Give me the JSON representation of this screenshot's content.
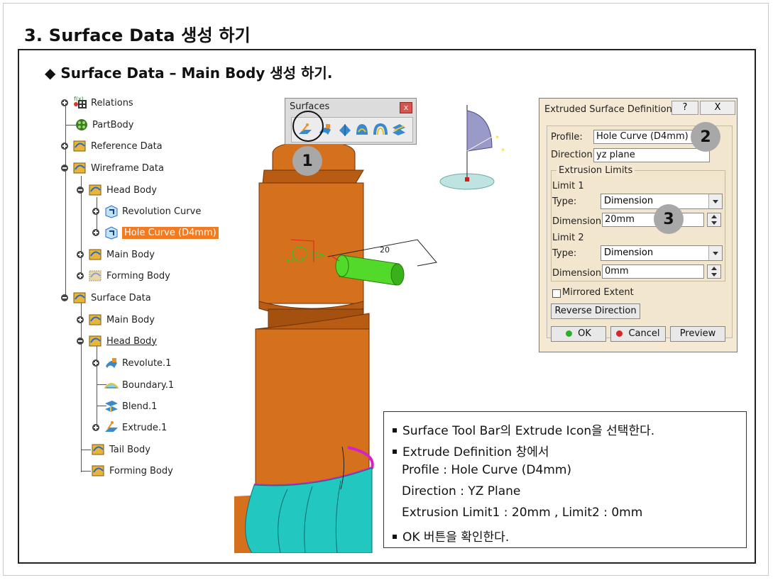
{
  "page": {
    "title": "3. Surface Data 생성 하기",
    "subtitle": "◆ Surface Data – Main Body 생성 하기."
  },
  "tree": {
    "items": [
      {
        "label": "Relations"
      },
      {
        "label": "PartBody"
      },
      {
        "label": "Reference Data"
      },
      {
        "label": "Wireframe Data"
      },
      {
        "label": "Head Body"
      },
      {
        "label": "Revolution Curve"
      },
      {
        "label": "Hole Curve (D4mm)"
      },
      {
        "label": "Main Body"
      },
      {
        "label": "Forming Body"
      },
      {
        "label": "Surface Data"
      },
      {
        "label": "Main Body"
      },
      {
        "label": "Head Body"
      },
      {
        "label": "Revolute.1"
      },
      {
        "label": "Boundary.1"
      },
      {
        "label": "Blend.1"
      },
      {
        "label": "Extrude.1"
      },
      {
        "label": "Tail Body"
      },
      {
        "label": "Forming Body"
      }
    ]
  },
  "toolbar": {
    "title": "Surfaces",
    "close": "x",
    "icons": [
      "extrude-icon",
      "revolve-icon",
      "sphere-icon",
      "cylinder-icon",
      "offset-icon",
      "variable-offset-icon"
    ]
  },
  "viewport": {
    "dimension": "20",
    "limit_label": "Limit 1",
    "colors": {
      "body": "#d5701d",
      "body_dark": "#8a3f08",
      "cylinder": "#52d92a",
      "surface": "#22c8c0",
      "edge": "#d522c8"
    }
  },
  "badges": {
    "b1": "1",
    "b2": "2",
    "b3": "3"
  },
  "dialog": {
    "title": "Extruded Surface Definition",
    "help": "?",
    "close": "X",
    "profile_label": "Profile:",
    "profile_value": "Hole Curve (D4mm)",
    "direction_label": "Direction:",
    "direction_value": "yz plane",
    "limits_title": "Extrusion Limits",
    "limit1_title": "Limit 1",
    "limit1_type_label": "Type:",
    "limit1_type_value": "Dimension",
    "limit1_dim_label": "Dimension:",
    "limit1_dim_value": "20mm",
    "limit2_title": "Limit 2",
    "limit2_type_label": "Type:",
    "limit2_type_value": "Dimension",
    "limit2_dim_label": "Dimension:",
    "limit2_dim_value": "0mm",
    "mirrored_label": "Mirrored Extent",
    "reverse_label": "Reverse Direction",
    "ok_label": "OK",
    "cancel_label": "Cancel",
    "preview_label": "Preview"
  },
  "notes": {
    "l1": "Surface Tool Bar의 Extrude Icon을 선택한다.",
    "l2": "Extrude Definition 창에서",
    "l3": "Profile : Hole Curve (D4mm)",
    "l4": "Direction : YZ Plane",
    "l5": "Extrusion Limit1 : 20mm , Limit2 : 0mm",
    "l6": "OK 버튼을 확인한다."
  }
}
